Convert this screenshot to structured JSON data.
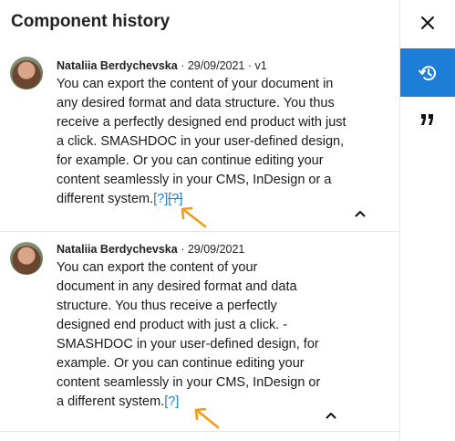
{
  "panel": {
    "title": "Component history"
  },
  "entries": [
    {
      "author": "Nataliia Berdychevska",
      "separator": " · ",
      "date": "29/09/2021",
      "version": "v1",
      "lines": [
        "You can export the content of your document in",
        "any desired format and data structure. You thus",
        "receive a perfectly designed end product with just",
        "a click. SMASHDOC in your user-defined design,",
        "for example. Or you can continue editing your",
        "content seamlessly in your CMS, InDesign or a"
      ],
      "last_line": "different system.",
      "link_1": "[?]",
      "link_2": "[?]"
    },
    {
      "author": "Nataliia Berdychevska",
      "separator": " · ",
      "date": "29/09/2021",
      "lines": [
        "You can export the content of your",
        "document in any desired format and data",
        "structure. You thus receive a perfectly",
        "designed end product with just a click. -",
        "SMASHDOC in your user-defined design, for",
        "example. Or you can continue editing your",
        "content seamlessly in your CMS, InDesign or"
      ],
      "last_line": "a different system.",
      "link_1": "[?]"
    }
  ],
  "icons": {
    "close": "close-icon",
    "history": "history-icon",
    "quote": "quote-icon",
    "collapse": "chevron-up-icon",
    "arrow": "arrow-annotation-icon"
  },
  "colors": {
    "accent": "#1c7ed6",
    "annotation": "#f39c12",
    "border": "#e6e6e6"
  }
}
